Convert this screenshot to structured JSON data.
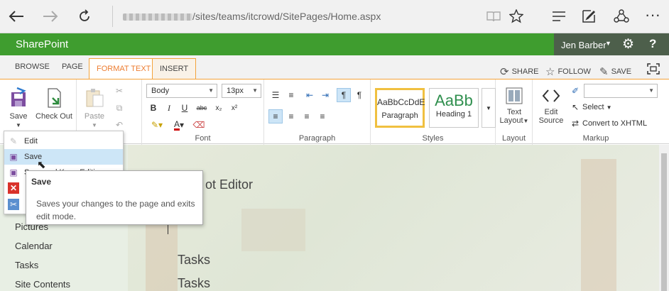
{
  "browser": {
    "url_path": "/sites/teams/itcrowd/SitePages/Home.aspx"
  },
  "suite": {
    "brand": "SharePoint",
    "user_name": "Jen Barber",
    "help": "?"
  },
  "tabs": {
    "browse": "BROWSE",
    "page": "PAGE",
    "format_text": "FORMAT TEXT",
    "insert": "INSERT"
  },
  "actions": {
    "share": "SHARE",
    "follow": "FOLLOW",
    "save": "SAVE"
  },
  "ribbon": {
    "save": "Save",
    "check_out": "Check Out",
    "paste": "Paste",
    "font_name": "Body",
    "font_size": "13px",
    "font_group": "Font",
    "paragraph_group": "Paragraph",
    "styles_group": "Styles",
    "style_paragraph_preview": "AaBbCcDdE",
    "style_paragraph_name": "Paragraph",
    "style_heading_preview": "AaBb",
    "style_heading_name": "Heading 1",
    "text_layout_1": "Text",
    "text_layout_2": "Layout",
    "layout_group": "Layout",
    "edit_source_1": "Edit",
    "edit_source_2": "Source",
    "select": "Select",
    "convert": "Convert to XHTML",
    "markup_group": "Markup"
  },
  "menu": {
    "edit": "Edit",
    "save": "Save",
    "stop_editing": "Save and Keep Editing"
  },
  "tooltip": {
    "title": "Save",
    "desc": "Saves your changes to the page and exits edit mode."
  },
  "content": {
    "title_fragment": "ot Editor",
    "nav": [
      "Pictures",
      "Calendar",
      "Tasks",
      "Site Contents"
    ],
    "tasks_1": "Tasks",
    "tasks_2": "Tasks"
  }
}
